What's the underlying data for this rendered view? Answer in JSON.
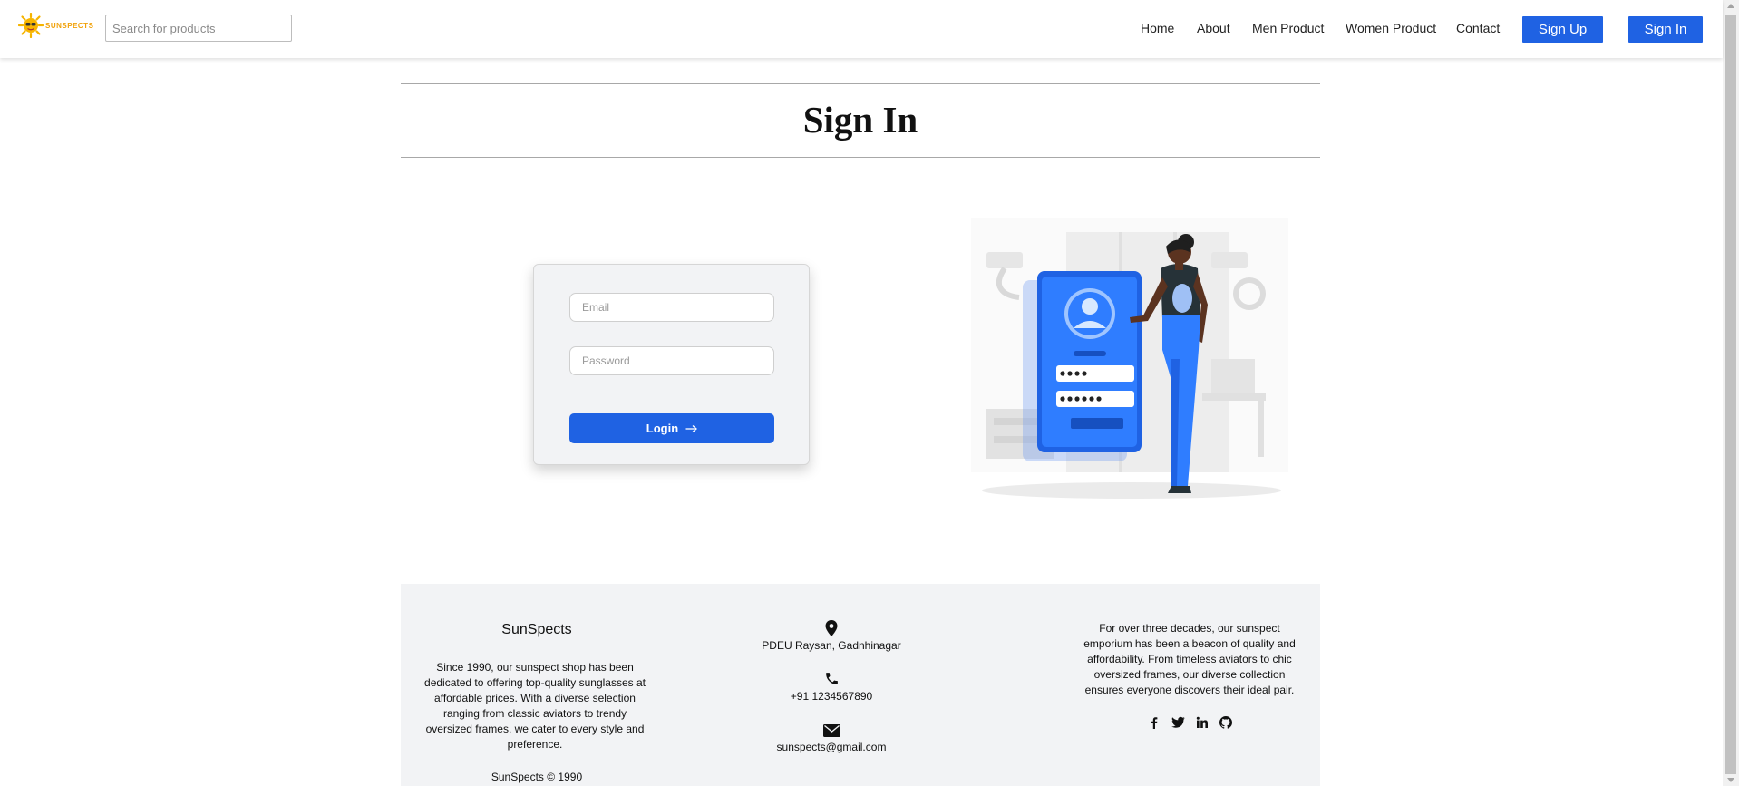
{
  "brand": {
    "name": "SUNSPECTS",
    "accent": "#f1a20b"
  },
  "search": {
    "placeholder": "Search for products"
  },
  "nav": {
    "links": [
      "Home",
      "About",
      "Men Product",
      "Women Product",
      "Contact"
    ],
    "signup": "Sign Up",
    "signin": "Sign In",
    "button_color": "#1f62e3"
  },
  "page": {
    "title": "Sign In"
  },
  "login": {
    "email_placeholder": "Email",
    "password_placeholder": "Password",
    "button": "Login",
    "button_icon": "arrow-right-icon",
    "illustration": "phone-login-illustration"
  },
  "footer": {
    "title": "SunSpects",
    "about": "Since 1990, our sunspect shop has been dedicated to offering top-quality sunglasses at affordable prices. With a diverse selection ranging from classic aviators to trendy oversized frames, we cater to every style and preference.",
    "copyright": "SunSpects © 1990",
    "address": "PDEU Raysan, Gadnhinagar",
    "phone": "+91 1234567890",
    "email": "sunspects@gmail.com",
    "description": "For over three decades, our sunspect emporium has been a beacon of quality and affordability. From timeless aviators to chic oversized frames, our diverse collection ensures everyone discovers their ideal pair.",
    "social_icons": [
      "facebook-icon",
      "twitter-icon",
      "linkedin-icon",
      "github-icon"
    ]
  }
}
